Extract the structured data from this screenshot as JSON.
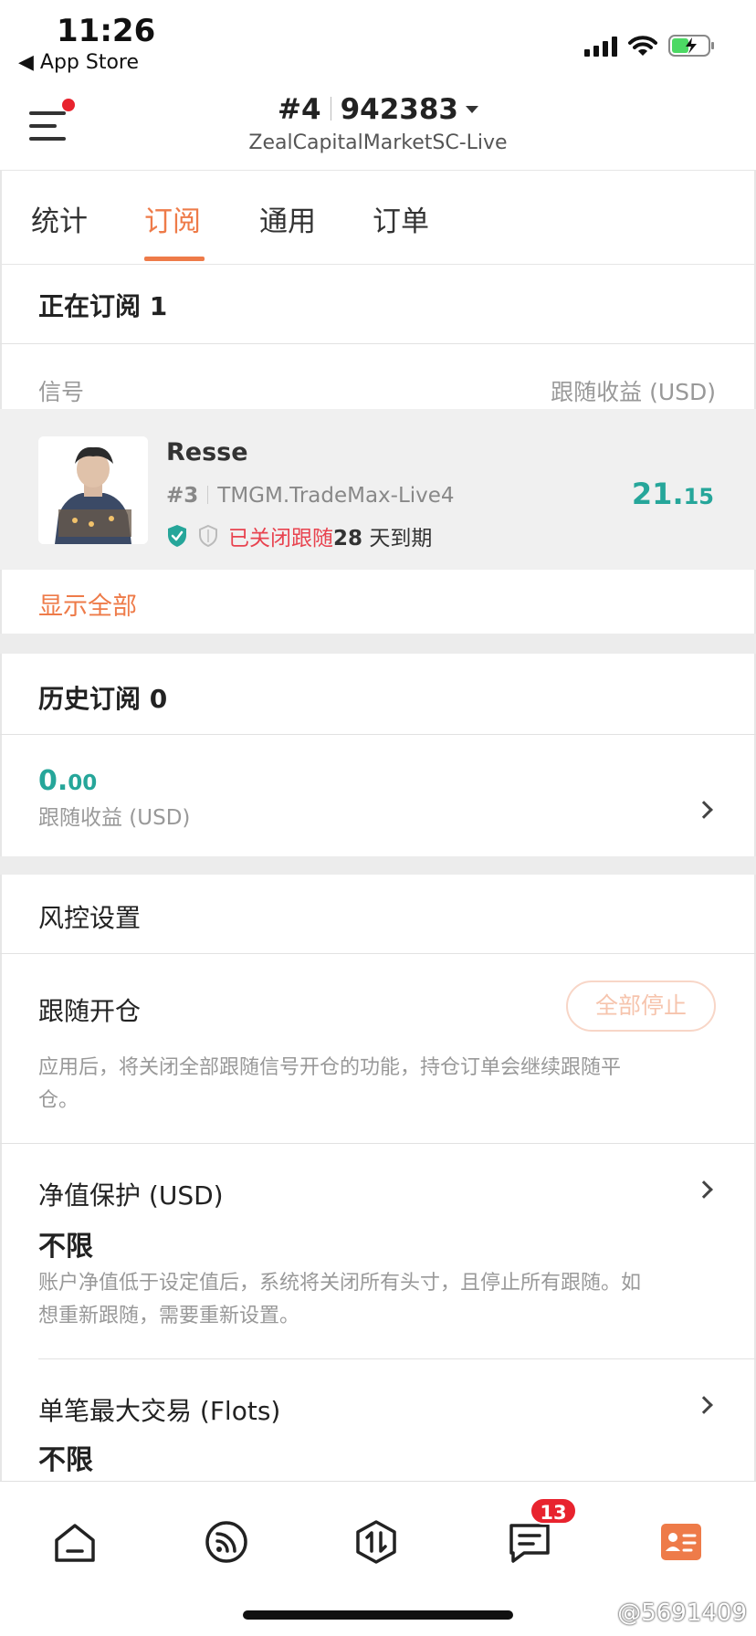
{
  "status_bar": {
    "time": "11:26",
    "back_app": "◀ App Store",
    "icons": [
      "signal-icon",
      "wifi-icon",
      "battery-charging-icon"
    ]
  },
  "header": {
    "account_prefix": "#4",
    "account_number": "942383",
    "server": "ZealCapitalMarketSC-Live",
    "menu_has_notification": true
  },
  "tabs": [
    {
      "label": "统计",
      "active": false
    },
    {
      "label": "订阅",
      "active": true
    },
    {
      "label": "通用",
      "active": false
    },
    {
      "label": "订单",
      "active": false
    }
  ],
  "current_subscriptions": {
    "title": "正在订阅 1",
    "col_signal": "信号",
    "col_profit": "跟随收益 (USD)",
    "items": [
      {
        "name": "Resse",
        "rank": "#3",
        "server": "TMGM.TradeMax-Live4",
        "status_closed": "已关闭跟随",
        "days": "28",
        "days_suffix": " 天到期",
        "profit_int": "21.",
        "profit_dec": "15"
      }
    ],
    "show_all": "显示全部"
  },
  "history": {
    "title": "历史订阅 0",
    "profit_int": "0.",
    "profit_dec": "00",
    "profit_label": "跟随收益 (USD)"
  },
  "risk": {
    "title": "风控设置",
    "follow_open": {
      "title": "跟随开仓",
      "button": "全部停止",
      "desc_line1": "应用后，将关闭全部跟随信号开仓的功能，持仓订单会继续跟随平",
      "desc_line2": "仓。"
    },
    "equity_protect": {
      "title": "净值保护 (USD)",
      "value": "不限",
      "desc_line1": "账户净值低于设定值后，系统将关闭所有头寸，且停止所有跟随。如",
      "desc_line2": "想重新跟随，需要重新设置。"
    },
    "max_trade": {
      "title": "单笔最大交易 (Flots)",
      "value": "不限"
    }
  },
  "bottom_nav": {
    "items": [
      "home-icon",
      "signal-feed-icon",
      "trade-icon",
      "message-icon",
      "profile-card-icon"
    ],
    "message_badge": "13",
    "active": "profile-card-icon"
  },
  "watermark": "@5691409",
  "colors": {
    "accent": "#ee7b49",
    "profit": "#26a69a",
    "alert": "#e8434f",
    "badge": "#e8232e"
  }
}
